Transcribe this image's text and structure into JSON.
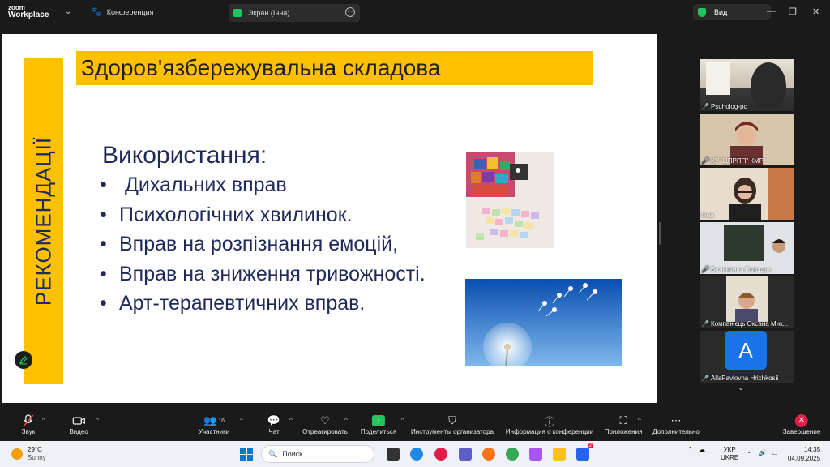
{
  "titlebar": {
    "logo_line1": "zoom",
    "logo_line2": "Workplace",
    "tab_conference": "Конференция",
    "tab_screen": "Экран (Інна)",
    "view_label": "Вид"
  },
  "slide": {
    "side_label": "РЕКОМЕНДАЦІЇ",
    "title": "Здоров'язбережувальна складова",
    "heading": "Використання:",
    "bullets": [
      "Дихальних вправ",
      "Психологічних хвилинок.",
      "Вправ на розпізнання емоцій,",
      "Вправ на зниження тривожності.",
      "Арт-терапевтичних вправ."
    ],
    "bullet_char": "•",
    "accent_color": "#ffc000",
    "text_color": "#1f2a5a"
  },
  "participants": [
    {
      "name": "Psuholog-pc",
      "muted": true
    },
    {
      "name": "КУ \"ЦПРПП\" КМР",
      "muted": true
    },
    {
      "name": "Інна",
      "muted": false,
      "active": true
    },
    {
      "name": "Валентина Голощак",
      "muted": true
    },
    {
      "name": "Компанієць Оксана Мик...",
      "muted": true
    },
    {
      "name": "AllaPavlovna Hrichkosii",
      "muted": true,
      "avatar_letter": "A"
    }
  ],
  "toolbar": {
    "audio": "Звук",
    "video": "Видео",
    "participants": "Участники",
    "participants_count": "16",
    "chat": "Чат",
    "react": "Отреагировать",
    "share": "Поделиться",
    "host_tools": "Инструменты организатора",
    "meeting_info": "Информация о конференции",
    "apps": "Приложения",
    "more": "Дополнительно",
    "end": "Завершение"
  },
  "taskbar": {
    "temperature": "29°C",
    "weather": "Sunny",
    "search_placeholder": "Поиск",
    "lang_line1": "УКР",
    "lang_line2": "UKRE",
    "time": "14:35",
    "date": "04.09.2025",
    "notification_count": "2"
  }
}
